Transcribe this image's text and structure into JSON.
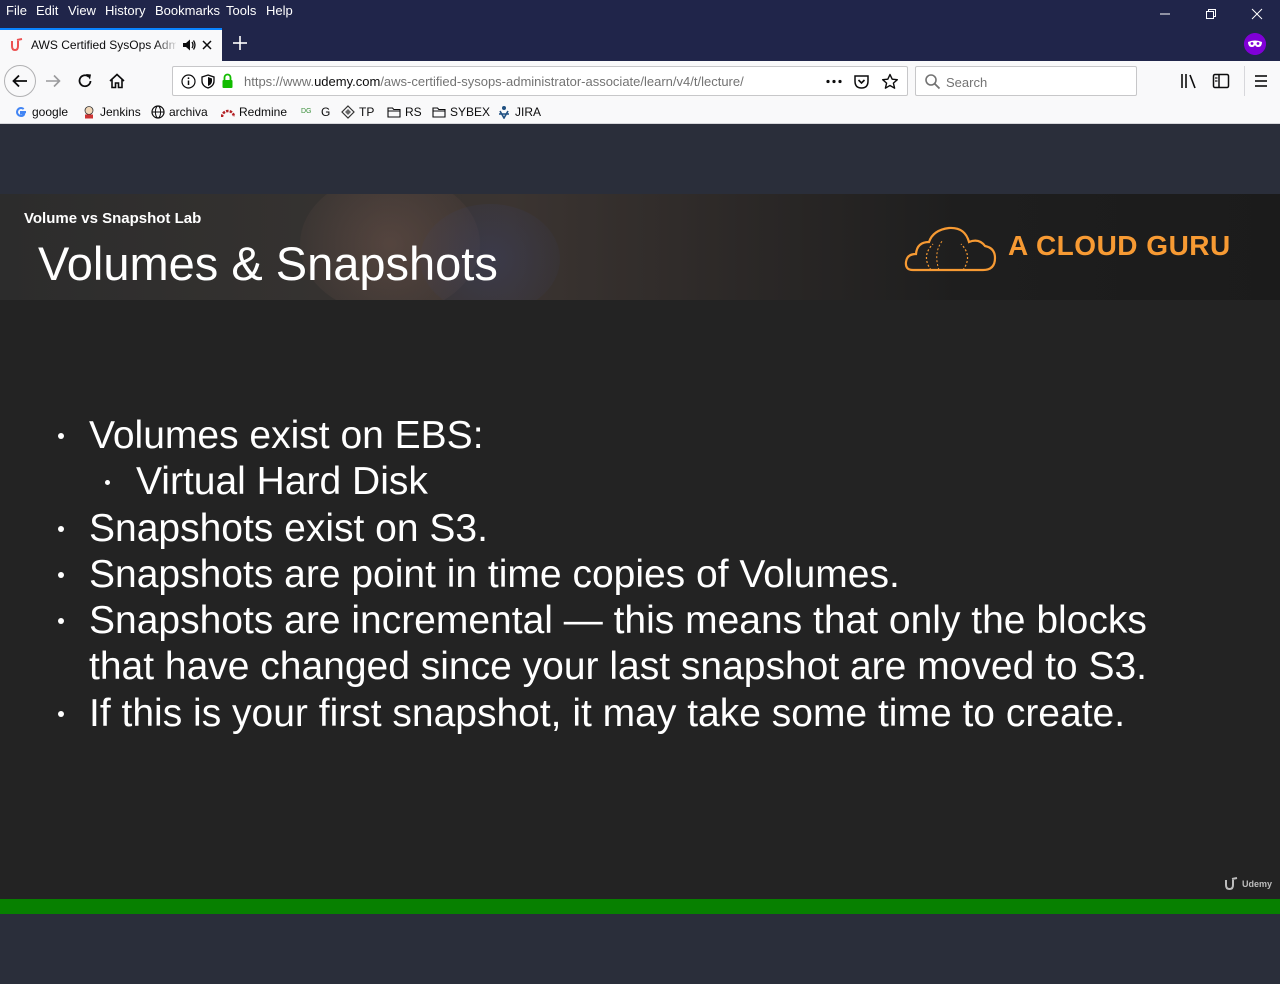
{
  "menubar": {
    "items": [
      {
        "label": "File"
      },
      {
        "label": "Edit"
      },
      {
        "label": "View"
      },
      {
        "label": "History"
      },
      {
        "label": "Bookmarks"
      },
      {
        "label": "Tools"
      },
      {
        "label": "Help"
      }
    ]
  },
  "tab": {
    "title": "AWS Certified SysOps Administrator",
    "favicon": "udemy-icon",
    "audio_icon": "speaker-icon"
  },
  "urlbar": {
    "url_prefix": "https://www.",
    "url_domain": "udemy.com",
    "url_rest": "/aws-certified-sysops-administrator-associate/learn/v4/t/lecture/"
  },
  "search": {
    "placeholder": "Search"
  },
  "bookmarks": [
    {
      "label": "google",
      "icon": "google-icon"
    },
    {
      "label": "Jenkins",
      "icon": "jenkins-icon"
    },
    {
      "label": "archiva",
      "icon": "globe-icon"
    },
    {
      "label": "Redmine",
      "icon": "redmine-icon"
    },
    {
      "label": "G",
      "icon": "dg-icon"
    },
    {
      "label": "TP",
      "icon": "diamond-icon"
    },
    {
      "label": "RS",
      "icon": "folder-icon"
    },
    {
      "label": "SYBEX",
      "icon": "folder-icon"
    },
    {
      "label": "JIRA",
      "icon": "jira-icon"
    }
  ],
  "slide": {
    "lab_title": "Volume vs Snapshot Lab",
    "title": "Volumes & Snapshots",
    "brand": "A CLOUD GURU",
    "brand_color": "#f79a33",
    "bullets": [
      "Volumes exist on EBS:",
      "Virtual Hard Disk",
      "Snapshots exist on S3.",
      "Snapshots are point in time copies of Volumes.",
      "Snapshots are incremental —  this means that only the blocks",
      "that have changed since your last snapshot are moved to S3.",
      "If this is your first snapshot, it may take some time to create."
    ],
    "watermark": "Udemy"
  },
  "player": {
    "progress_color": "#078000"
  }
}
